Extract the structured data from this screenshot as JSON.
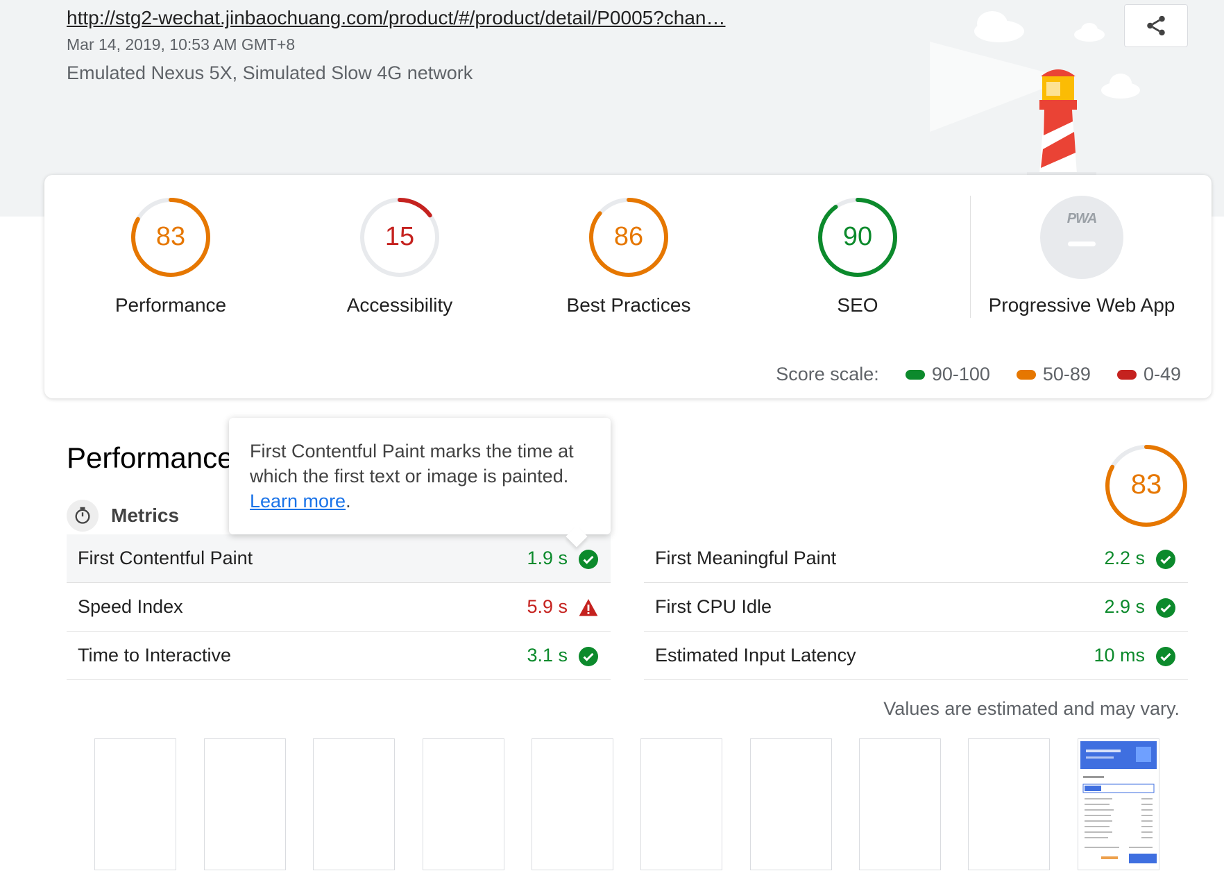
{
  "header": {
    "url": "http://stg2-wechat.jinbaochuang.com/product/#/product/detail/P0005?chan…",
    "date": "Mar 14, 2019, 10:53 AM GMT+8",
    "device": "Emulated Nexus 5X, Simulated Slow 4G network",
    "share_icon": "share-icon"
  },
  "colors": {
    "pass": "#0c8a2c",
    "average": "#e67700",
    "fail": "#c5221f",
    "track": "#e8eaed"
  },
  "gauges": [
    {
      "score": "83",
      "label": "Performance",
      "value": 0.83,
      "rating": "average"
    },
    {
      "score": "15",
      "label": "Accessibility",
      "value": 0.15,
      "rating": "fail"
    },
    {
      "score": "86",
      "label": "Best Practices",
      "value": 0.86,
      "rating": "average"
    },
    {
      "score": "90",
      "label": "SEO",
      "value": 0.9,
      "rating": "pass"
    }
  ],
  "pwa": {
    "badge": "PWA",
    "label": "Progressive Web App"
  },
  "scale": {
    "label": "Score scale:",
    "ranges": [
      "90-100",
      "50-89",
      "0-49"
    ]
  },
  "performance": {
    "title": "Performance",
    "score": "83",
    "score_value": 0.83,
    "metrics_label": "Metrics",
    "metrics_left": [
      {
        "name": "First Contentful Paint",
        "value": "1.9 s",
        "status": "pass"
      },
      {
        "name": "Speed Index",
        "value": "5.9 s",
        "status": "fail"
      },
      {
        "name": "Time to Interactive",
        "value": "3.1 s",
        "status": "pass"
      }
    ],
    "metrics_right": [
      {
        "name": "First Meaningful Paint",
        "value": "2.2 s",
        "status": "pass"
      },
      {
        "name": "First CPU Idle",
        "value": "2.9 s",
        "status": "pass"
      },
      {
        "name": "Estimated Input Latency",
        "value": "10 ms",
        "status": "pass"
      }
    ],
    "note": "Values are estimated and may vary."
  },
  "tooltip": {
    "text": "First Contentful Paint marks the time at which the first text or image is painted.",
    "link": "Learn more",
    "end": "."
  }
}
